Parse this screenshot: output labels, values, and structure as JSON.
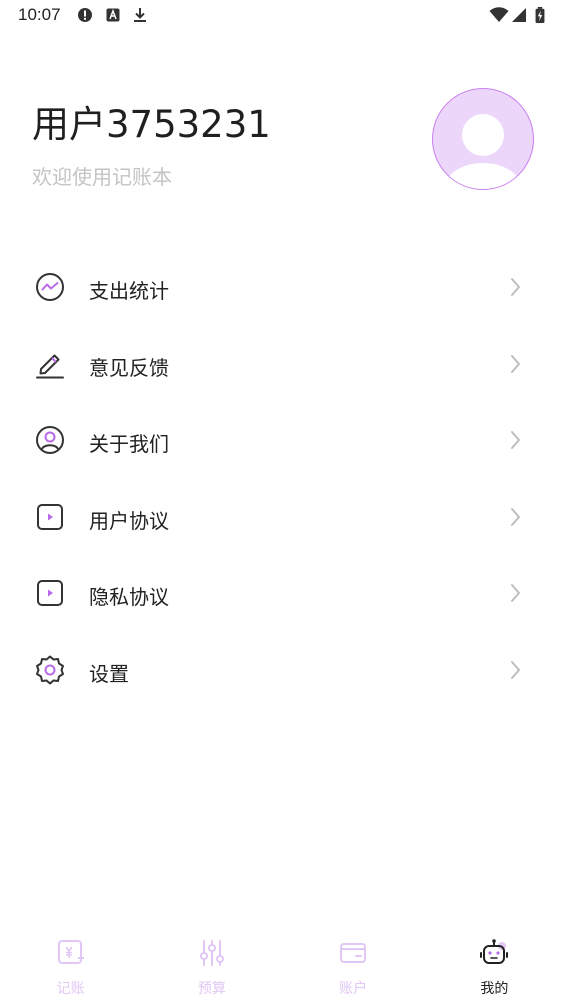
{
  "status_bar": {
    "time": "10:07",
    "left_icons": [
      "alert-circle-icon",
      "font-a-icon",
      "download-icon"
    ],
    "right_icons": [
      "wifi-icon",
      "signal-icon",
      "battery-charging-icon"
    ]
  },
  "profile": {
    "username": "用户3753231",
    "subtitle": "欢迎使用记账本",
    "avatar_icon": "default-avatar-icon"
  },
  "menu": {
    "items": [
      {
        "label": "支出统计",
        "icon": "chart-circle-icon"
      },
      {
        "label": "意见反馈",
        "icon": "edit-pen-icon"
      },
      {
        "label": "关于我们",
        "icon": "user-circle-icon"
      },
      {
        "label": "用户协议",
        "icon": "play-square-icon"
      },
      {
        "label": "隐私协议",
        "icon": "play-square-icon"
      },
      {
        "label": "设置",
        "icon": "gear-icon"
      }
    ]
  },
  "bottom_nav": {
    "items": [
      {
        "label": "记账",
        "icon": "bookkeeping-icon",
        "active": false
      },
      {
        "label": "预算",
        "icon": "sliders-icon",
        "active": false
      },
      {
        "label": "账户",
        "icon": "wallet-icon",
        "active": false
      },
      {
        "label": "我的",
        "icon": "robot-icon",
        "active": true
      }
    ]
  },
  "colors": {
    "accent": "#b86ae8",
    "accent_light": "#e0c7f5",
    "avatar_bg": "#ecd7fb",
    "text_primary": "#222222",
    "text_secondary": "#c4c4c4",
    "chevron": "#bdbdbd"
  }
}
